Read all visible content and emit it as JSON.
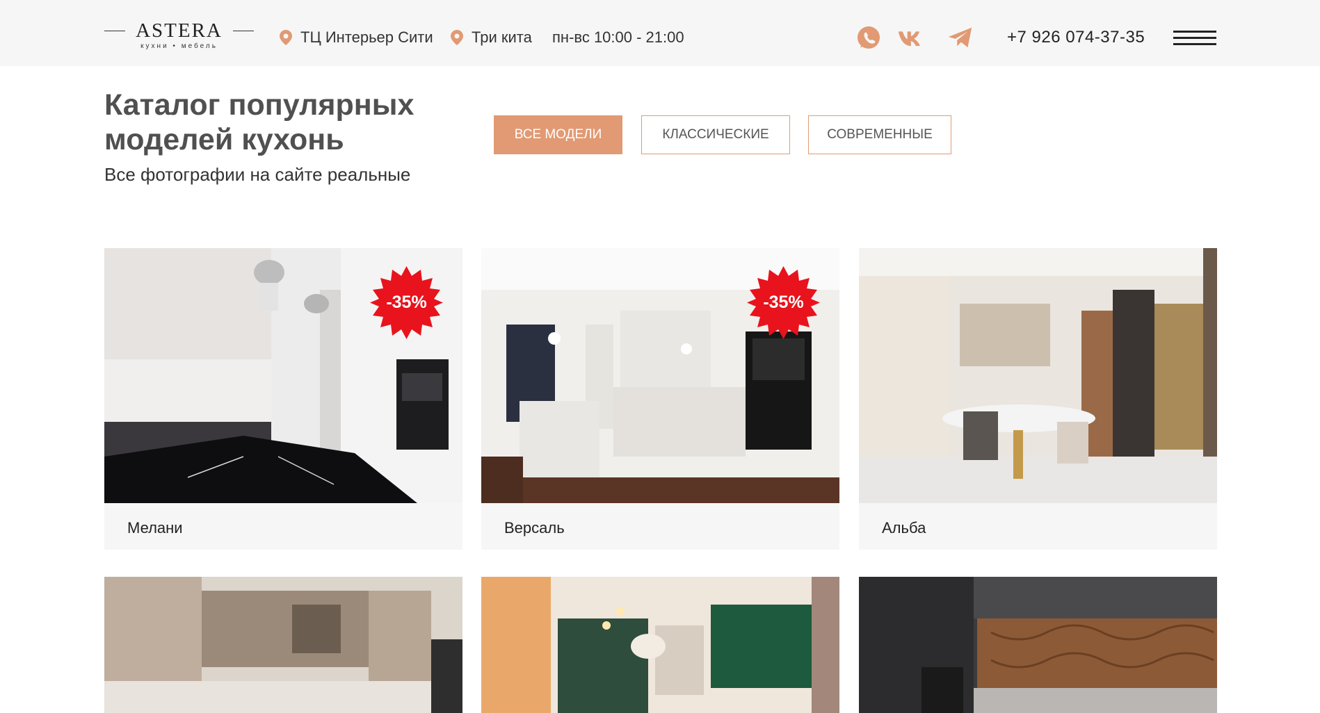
{
  "header": {
    "logo": {
      "main": "ASTERA",
      "sub": "кухни • мебель"
    },
    "address1": "ТЦ Интерьер Сити",
    "address2": "Три кита",
    "hours": "пн-вс 10:00 - 21:00",
    "social": [
      "whatsapp-icon",
      "vk-icon",
      "telegram-icon"
    ],
    "phone": "+7 926 074-37-35"
  },
  "catalog": {
    "title": "Каталог популярных моделей кухонь",
    "subtitle": "Все фотографии на сайте реальные",
    "filters": [
      "ВСЕ МОДЕЛИ",
      "КЛАССИЧЕСКИЕ",
      "СОВРЕМЕННЫЕ"
    ],
    "active_filter": "ВСЕ МОДЕЛИ"
  },
  "products": [
    {
      "name": "Мелани",
      "badge": "-35%"
    },
    {
      "name": "Версаль",
      "badge": "-35%"
    },
    {
      "name": "Альба"
    },
    {
      "name": ""
    },
    {
      "name": ""
    },
    {
      "name": ""
    }
  ],
  "colors": {
    "accent": "#e19a73",
    "badge": "#e8131c",
    "header_bg": "#f6f6f6",
    "card_bg": "#f6f6f6"
  }
}
